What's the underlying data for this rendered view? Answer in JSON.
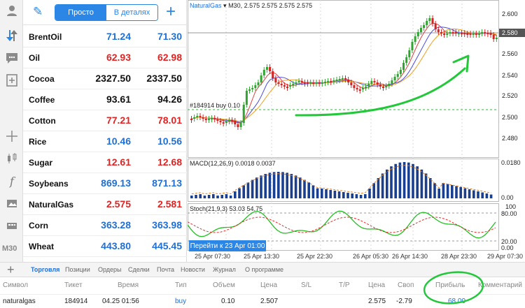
{
  "rail": {
    "icons": [
      "user-icon",
      "trade-arrows-icon",
      "chat-icon",
      "add-chart-icon",
      "crosshair-icon",
      "candles-icon",
      "indicator-icon",
      "objects-icon",
      "templates-icon"
    ],
    "timeframe": "M30"
  },
  "quotes": {
    "mode_simple": "Просто",
    "mode_detailed": "В деталях",
    "rows": [
      {
        "symbol": "BrentOil",
        "bid": "71.24",
        "ask": "71.30",
        "bid_color": "#1f6fd6",
        "ask_color": "#1f6fd6"
      },
      {
        "symbol": "Oil",
        "bid": "62.93",
        "ask": "62.98",
        "bid_color": "#e02424",
        "ask_color": "#e02424"
      },
      {
        "symbol": "Cocoa",
        "bid": "2327.50",
        "ask": "2337.50",
        "bid_color": "#111111",
        "ask_color": "#111111"
      },
      {
        "symbol": "Coffee",
        "bid": "93.61",
        "ask": "94.26",
        "bid_color": "#111111",
        "ask_color": "#111111"
      },
      {
        "symbol": "Cotton",
        "bid": "77.21",
        "ask": "78.01",
        "bid_color": "#e02424",
        "ask_color": "#e02424"
      },
      {
        "symbol": "Rice",
        "bid": "10.46",
        "ask": "10.56",
        "bid_color": "#1f6fd6",
        "ask_color": "#1f6fd6"
      },
      {
        "symbol": "Sugar",
        "bid": "12.61",
        "ask": "12.68",
        "bid_color": "#e02424",
        "ask_color": "#e02424"
      },
      {
        "symbol": "Soybeans",
        "bid": "869.13",
        "ask": "871.13",
        "bid_color": "#1f6fd6",
        "ask_color": "#1f6fd6"
      },
      {
        "symbol": "NaturalGas",
        "bid": "2.575",
        "ask": "2.581",
        "bid_color": "#e02424",
        "ask_color": "#e02424"
      },
      {
        "symbol": "Corn",
        "bid": "363.28",
        "ask": "363.98",
        "bid_color": "#1f6fd6",
        "ask_color": "#1f6fd6"
      },
      {
        "symbol": "Wheat",
        "bid": "443.80",
        "ask": "445.45",
        "bid_color": "#1f6fd6",
        "ask_color": "#1f6fd6"
      }
    ]
  },
  "chart": {
    "symbol": "NaturalGas",
    "header_rest": "▾ M30, 2.575 2.575 2.575 2.575",
    "price_labels": [
      "2.600",
      "2.580",
      "2.560",
      "2.540",
      "2.520",
      "2.500",
      "2.480"
    ],
    "current_price": "2.580",
    "order_label": "#184914 buy 0.10",
    "macd_label": "MACD(12,26,9) 0.0018 0.0037",
    "macd_scale": [
      "0.0180",
      "0.00"
    ],
    "stoch_label": "Stoch(21,9,3) 53.03 54.75",
    "stoch_scale": [
      "100",
      "80.00",
      "20.00",
      "0.00"
    ],
    "goto_label": "Перейти к 23 Apr 01:00",
    "time_labels": [
      "25 Apr 07:30",
      "25 Apr 13:30",
      "25 Apr 22:30",
      "26 Apr 05:30",
      "26 Apr 14:30",
      "28 Apr 23:30",
      "29 Apr 07:30"
    ],
    "colors": {
      "bull": "#2fa52f",
      "bear": "#d32323",
      "ma_red": "#e04040",
      "ma_blue": "#4a4ae0",
      "ma_orange": "#f0a020",
      "macd_bars": "#1b3f8f",
      "stoch_main": "#22c022",
      "stoch_signal": "#e03030",
      "annotation": "#22c83a"
    }
  },
  "tabs": {
    "items": [
      "Торговля",
      "Позиции",
      "Ордеры",
      "Сделки",
      "Почта",
      "Новости",
      "Журнал",
      "О программе"
    ],
    "active": "Торговля"
  },
  "positions": {
    "headers": [
      "Символ",
      "Тикет",
      "Время",
      "Тип",
      "Объем",
      "Цена",
      "S/L",
      "T/P",
      "Цена",
      "Своп",
      "Прибыль",
      "Комментарий"
    ],
    "row": {
      "symbol": "naturalgas",
      "ticket": "184914",
      "time": "04.25 01:56",
      "type": "buy",
      "volume": "0.10",
      "open_price": "2.507",
      "sl": "",
      "tp": "",
      "price": "2.575",
      "swap": "-2.79",
      "profit": "68.00",
      "comment": ""
    }
  }
}
